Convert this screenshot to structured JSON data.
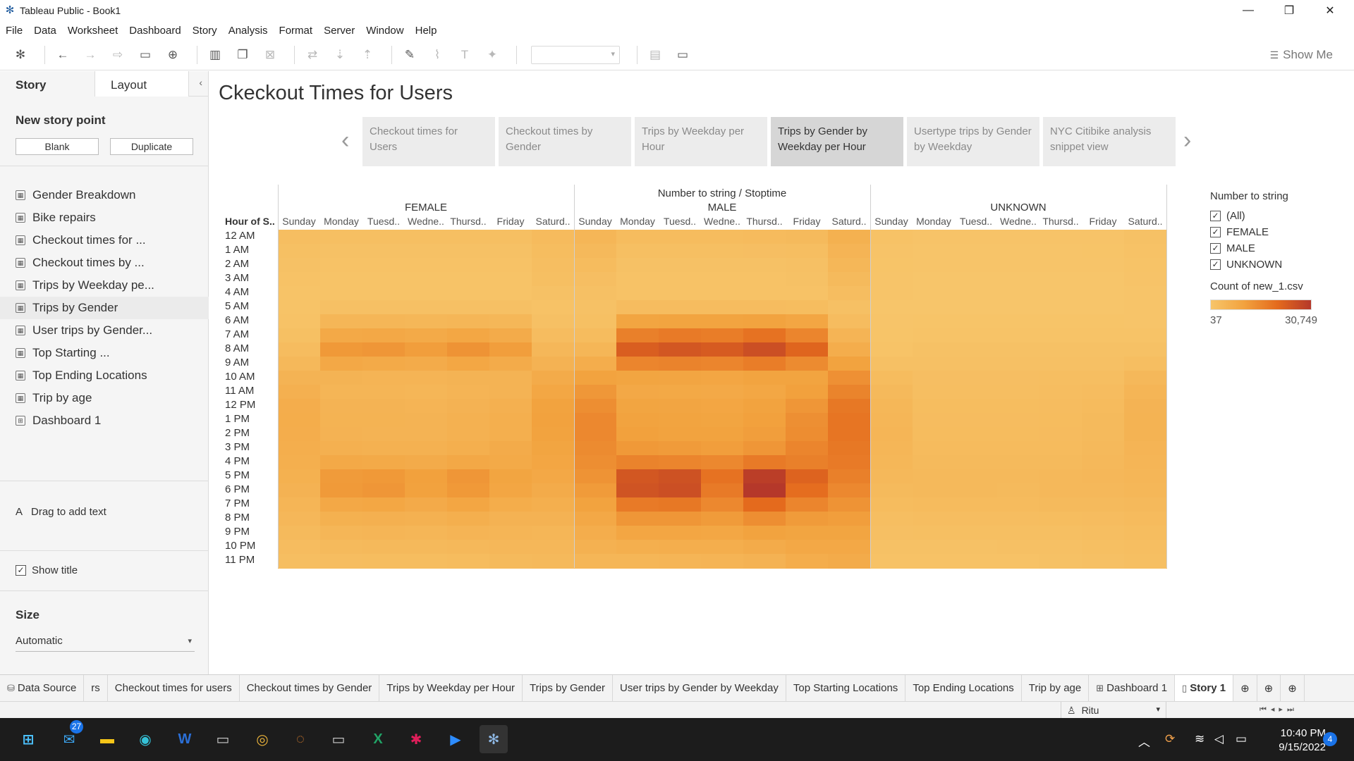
{
  "window": {
    "title": "Tableau Public - Book1",
    "controls": {
      "minimize": "—",
      "restore": "❐",
      "close": "✕"
    }
  },
  "menu": [
    "File",
    "Data",
    "Worksheet",
    "Dashboard",
    "Story",
    "Analysis",
    "Format",
    "Server",
    "Window",
    "Help"
  ],
  "toolbar": {
    "show_me": "Show Me",
    "icons": [
      "tableau-logo-icon",
      "undo-icon",
      "redo-icon",
      "replay-icon",
      "save-icon",
      "new-datasource-icon",
      "new-worksheet-icon",
      "duplicate-icon",
      "clear-icon",
      "swap-icon",
      "sort-asc-icon",
      "sort-desc-icon",
      "highlight-icon",
      "group-icon",
      "label-icon",
      "pin-icon",
      "fit-icon",
      "presentation-icon"
    ]
  },
  "left_pane": {
    "tabs": [
      "Story",
      "Layout"
    ],
    "new_story_point": "New story point",
    "blank_button": "Blank",
    "duplicate_button": "Duplicate",
    "sheets": [
      {
        "label": "Gender Breakdown",
        "type": "worksheet"
      },
      {
        "label": "Bike repairs",
        "type": "worksheet"
      },
      {
        "label": "Checkout times for ...",
        "type": "worksheet"
      },
      {
        "label": "Checkout times by ...",
        "type": "worksheet"
      },
      {
        "label": "Trips by Weekday pe...",
        "type": "worksheet"
      },
      {
        "label": "Trips by Gender",
        "type": "worksheet"
      },
      {
        "label": "User trips by Gender...",
        "type": "worksheet"
      },
      {
        "label": "Top Starting ...",
        "type": "worksheet"
      },
      {
        "label": "Top Ending Locations",
        "type": "worksheet"
      },
      {
        "label": "Trip by age",
        "type": "worksheet"
      },
      {
        "label": "Dashboard 1",
        "type": "dashboard"
      }
    ],
    "selected_sheet_index": 5,
    "drag_text": "Drag to add text",
    "show_title": "Show title",
    "size_label": "Size",
    "size_value": "Automatic"
  },
  "story": {
    "title": "Ckeckout Times for Users",
    "points": [
      "Checkout times for Users",
      "Checkout times by Gender",
      "Trips by Weekday per Hour",
      "Trips by Gender by Weekday per Hour",
      "Usertype trips by Gender by Weekday",
      "NYC Citibike analysis snippet view"
    ],
    "active_point": 3
  },
  "chart_data": {
    "type": "heatmap",
    "title": "Number to string / Stoptime",
    "row_header": "Hour of S..",
    "groups": [
      "FEMALE",
      "MALE",
      "UNKNOWN"
    ],
    "days": [
      "Sunday",
      "Monday",
      "Tuesd..",
      "Wedne..",
      "Thursd..",
      "Friday",
      "Saturd.."
    ],
    "hours": [
      "12 AM",
      "1 AM",
      "2 AM",
      "3 AM",
      "4 AM",
      "5 AM",
      "6 AM",
      "7 AM",
      "8 AM",
      "9 AM",
      "10 AM",
      "11 AM",
      "12 PM",
      "1 PM",
      "2 PM",
      "3 PM",
      "4 PM",
      "5 PM",
      "6 PM",
      "7 PM",
      "8 PM",
      "9 PM",
      "10 PM",
      "11 PM"
    ],
    "color_range": [
      37,
      30749
    ],
    "colors": [
      "#f7c56a",
      "#f2a23e",
      "#e46a1d",
      "#b5382a"
    ],
    "values": {
      "FEMALE": [
        [
          2200,
          1900,
          1900,
          1900,
          1900,
          1900,
          3000
        ],
        [
          1600,
          1300,
          1300,
          1300,
          1300,
          1300,
          2500
        ],
        [
          1200,
          900,
          900,
          900,
          900,
          900,
          2200
        ],
        [
          900,
          700,
          700,
          700,
          700,
          700,
          1800
        ],
        [
          700,
          700,
          700,
          700,
          700,
          700,
          1300
        ],
        [
          700,
          1400,
          1400,
          1400,
          1400,
          1400,
          900
        ],
        [
          1000,
          4500,
          4500,
          4200,
          4500,
          4200,
          1500
        ],
        [
          1600,
          8200,
          8500,
          8000,
          8800,
          7500,
          2600
        ],
        [
          2600,
          12000,
          12500,
          11000,
          13000,
          11000,
          4000
        ],
        [
          3800,
          8500,
          8000,
          7500,
          8800,
          7500,
          5500
        ],
        [
          5200,
          5200,
          5000,
          5000,
          5200,
          5200,
          7500
        ],
        [
          6200,
          4800,
          4800,
          4500,
          5000,
          5200,
          8800
        ],
        [
          7000,
          5200,
          5200,
          5000,
          5500,
          6200,
          10000
        ],
        [
          7200,
          5400,
          5400,
          5200,
          5800,
          6500,
          10200
        ],
        [
          7000,
          5500,
          5200,
          5200,
          5800,
          6500,
          10000
        ],
        [
          6800,
          6200,
          5800,
          5800,
          6500,
          7500,
          9500
        ],
        [
          6500,
          8200,
          8000,
          7500,
          8500,
          8000,
          9000
        ],
        [
          6000,
          11500,
          12000,
          10500,
          12500,
          9500,
          8500
        ],
        [
          5500,
          11800,
          12500,
          10200,
          12000,
          9000,
          7500
        ],
        [
          4800,
          8500,
          8800,
          7800,
          9000,
          7200,
          6500
        ],
        [
          4000,
          6000,
          6200,
          5800,
          6500,
          5500,
          5500
        ],
        [
          3200,
          4500,
          4700,
          4500,
          5000,
          4800,
          4500
        ],
        [
          2600,
          3300,
          3500,
          3500,
          3800,
          4000,
          4000
        ],
        [
          2100,
          2300,
          2500,
          2500,
          2800,
          3300,
          3500
        ]
      ],
      "MALE": [
        [
          4500,
          2800,
          2800,
          2800,
          3000,
          3200,
          6000
        ],
        [
          3500,
          1800,
          1800,
          1800,
          2000,
          2200,
          5000
        ],
        [
          2800,
          1200,
          1200,
          1200,
          1300,
          1500,
          4200
        ],
        [
          2000,
          900,
          900,
          900,
          1000,
          1100,
          3400
        ],
        [
          1400,
          900,
          900,
          900,
          900,
          1000,
          2400
        ],
        [
          1100,
          2600,
          2600,
          2600,
          2600,
          2500,
          1500
        ],
        [
          1600,
          9500,
          9800,
          9800,
          10000,
          9000,
          2600
        ],
        [
          2800,
          16500,
          17500,
          17000,
          19000,
          15500,
          5000
        ],
        [
          4500,
          23000,
          24500,
          23500,
          26000,
          21500,
          7000
        ],
        [
          7000,
          15500,
          16000,
          15500,
          17000,
          14500,
          10000
        ],
        [
          10000,
          9500,
          9300,
          9200,
          9800,
          9800,
          13500
        ],
        [
          12200,
          8500,
          8300,
          8200,
          8800,
          10500,
          15800
        ],
        [
          14000,
          9500,
          9300,
          9000,
          10000,
          12500,
          18000
        ],
        [
          15000,
          10000,
          9800,
          9500,
          10500,
          13800,
          18500
        ],
        [
          15000,
          10500,
          10000,
          10000,
          11000,
          14200,
          18500
        ],
        [
          14500,
          12000,
          11500,
          11000,
          12500,
          15500,
          18000
        ],
        [
          14000,
          16000,
          15500,
          15000,
          17500,
          16500,
          17500
        ],
        [
          13000,
          24500,
          25500,
          19000,
          29500,
          22000,
          16500
        ],
        [
          11500,
          25000,
          26000,
          17500,
          30749,
          20000,
          15000
        ],
        [
          10000,
          17500,
          18000,
          15000,
          20500,
          15500,
          13000
        ],
        [
          8500,
          12500,
          12500,
          11500,
          14000,
          11500,
          11000
        ],
        [
          7000,
          9000,
          9200,
          8800,
          10000,
          9500,
          9500
        ],
        [
          5800,
          6500,
          6800,
          6800,
          7500,
          8500,
          8500
        ],
        [
          4500,
          4500,
          4800,
          5000,
          5500,
          7000,
          7500
        ]
      ],
      "UNKNOWN": [
        [
          900,
          500,
          500,
          500,
          500,
          600,
          1200
        ],
        [
          600,
          300,
          300,
          300,
          300,
          400,
          900
        ],
        [
          400,
          200,
          200,
          200,
          200,
          250,
          700
        ],
        [
          300,
          150,
          150,
          150,
          150,
          150,
          500
        ],
        [
          200,
          120,
          120,
          120,
          120,
          120,
          350
        ],
        [
          120,
          150,
          150,
          150,
          150,
          150,
          200
        ],
        [
          200,
          400,
          400,
          400,
          400,
          400,
          350
        ],
        [
          400,
          700,
          700,
          700,
          700,
          700,
          700
        ],
        [
          700,
          1100,
          1100,
          1100,
          1200,
          1100,
          1200
        ],
        [
          1500,
          1400,
          1400,
          1400,
          1500,
          1500,
          2200
        ],
        [
          2800,
          2000,
          2000,
          2000,
          2100,
          2200,
          3800
        ],
        [
          3500,
          2200,
          2200,
          2200,
          2300,
          2600,
          4800
        ],
        [
          4200,
          2500,
          2500,
          2500,
          2600,
          3000,
          5200
        ],
        [
          4500,
          2700,
          2700,
          2700,
          2800,
          3200,
          5400
        ],
        [
          4600,
          2800,
          2800,
          2800,
          2900,
          3400,
          5300
        ],
        [
          4500,
          3000,
          3000,
          3000,
          3100,
          3600,
          5000
        ],
        [
          4200,
          3200,
          3200,
          3200,
          3400,
          3800,
          4800
        ],
        [
          3800,
          3600,
          3600,
          3500,
          3800,
          4000,
          4500
        ],
        [
          3400,
          3500,
          3500,
          3400,
          3700,
          3800,
          4200
        ],
        [
          2800,
          3000,
          3000,
          3000,
          3200,
          3300,
          3600
        ],
        [
          2200,
          2400,
          2400,
          2400,
          2500,
          2700,
          3000
        ],
        [
          1700,
          1800,
          1800,
          1800,
          1900,
          2200,
          2500
        ],
        [
          1300,
          1300,
          1300,
          1400,
          1500,
          1800,
          2100
        ],
        [
          900,
          900,
          900,
          1000,
          1100,
          1500,
          1800
        ]
      ]
    }
  },
  "legend": {
    "filter_title": "Number to string",
    "filter_items": [
      "(All)",
      "FEMALE",
      "MALE",
      "UNKNOWN"
    ],
    "color_title": "Count of new_1.csv",
    "min_label": "37",
    "max_label": "30,749"
  },
  "sheet_tabs": [
    {
      "label": "Data Source",
      "icon": "database-icon"
    },
    {
      "label": "rs",
      "icon": ""
    },
    {
      "label": "Checkout times for users",
      "icon": ""
    },
    {
      "label": "Checkout times by Gender",
      "icon": ""
    },
    {
      "label": "Trips by Weekday per Hour",
      "icon": ""
    },
    {
      "label": "Trips by Gender",
      "icon": ""
    },
    {
      "label": "User trips by Gender by Weekday",
      "icon": ""
    },
    {
      "label": "Top Starting Locations",
      "icon": ""
    },
    {
      "label": "Top Ending Locations",
      "icon": ""
    },
    {
      "label": "Trip by age",
      "icon": ""
    },
    {
      "label": "Dashboard 1",
      "icon": "dashboard-icon"
    },
    {
      "label": "Story 1",
      "icon": "story-icon"
    }
  ],
  "active_sheet_tab": 11,
  "status": {
    "user": "Ritu"
  },
  "taskbar": {
    "mail_badge": "27",
    "time": "10:40 PM",
    "date": "9/15/2022",
    "notifications": "4"
  }
}
